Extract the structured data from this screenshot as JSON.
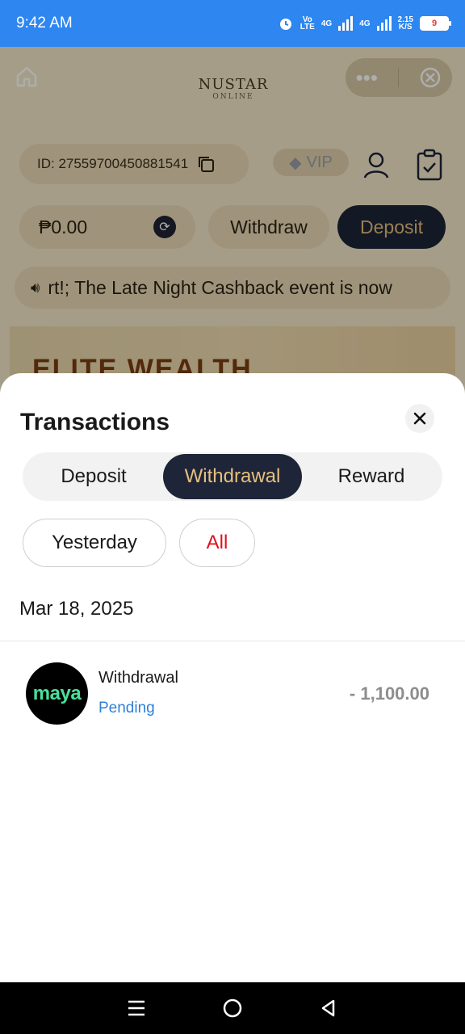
{
  "status_bar": {
    "time": "9:42 AM",
    "volte": "Vo\nLTE",
    "net1": "4G",
    "net2": "4G",
    "speed": "2.15",
    "speed_unit": "K/S",
    "battery": "9"
  },
  "background_app": {
    "brand_name": "NUSTAR",
    "brand_sub": "ONLINE",
    "user_id": "ID: 27559700450881541",
    "vip_label": "VIP",
    "balance": "₱0.00",
    "withdraw_label": "Withdraw",
    "deposit_label": "Deposit",
    "marquee_text": "rt!; The Late Night Cashback event is now",
    "banner_text": "ELITE WEALTH"
  },
  "sheet": {
    "title": "Transactions",
    "tabs": [
      {
        "label": "Deposit",
        "active": false
      },
      {
        "label": "Withdrawal",
        "active": true
      },
      {
        "label": "Reward",
        "active": false
      }
    ],
    "filters": [
      {
        "label": "Yesterday",
        "selected": false
      },
      {
        "label": "All",
        "selected": true
      }
    ],
    "groups": [
      {
        "date": "Mar 18, 2025",
        "transactions": [
          {
            "method_logo": "maya",
            "type": "Withdrawal",
            "status": "Pending",
            "amount": "- 1,100.00"
          }
        ]
      }
    ]
  },
  "colors": {
    "status_bar": "#2e86f0",
    "active_tab_bg": "#1f2538",
    "active_tab_text": "#e6c07f",
    "selected_filter_text": "#e0121f",
    "pending_status": "#2f7fd6",
    "maya_green": "#48e09c"
  }
}
